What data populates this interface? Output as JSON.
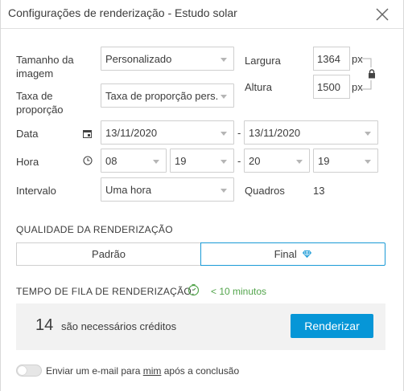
{
  "dialog": {
    "title": "Configurações de renderização - Estudo solar"
  },
  "form": {
    "image_size": {
      "label_line1": "Tamanho da",
      "label_line2": "imagem",
      "value": "Personalizado"
    },
    "aspect_ratio": {
      "label_line1": "Taxa de",
      "label_line2": "proporção",
      "value": "Taxa de proporção pers..."
    },
    "width": {
      "label": "Largura",
      "value": "1364",
      "unit": "px"
    },
    "height": {
      "label": "Altura",
      "value": "1500",
      "unit": "px"
    },
    "date": {
      "label": "Data",
      "start": "13/11/2020",
      "end": "13/11/2020",
      "separator": "-"
    },
    "time": {
      "label": "Hora",
      "start_hour": "08",
      "start_minute": "19",
      "end_hour": "20",
      "end_minute": "19",
      "separator": "-"
    },
    "interval": {
      "label": "Intervalo",
      "value": "Uma hora"
    },
    "frames": {
      "label": "Quadros",
      "value": "13"
    }
  },
  "quality": {
    "title": "QUALIDADE DA RENDERIZAÇÃO",
    "options": [
      "Padrão",
      "Final"
    ],
    "selected": "Final"
  },
  "queue": {
    "label": "TEMPO DE FILA DE RENDERIZAÇÃO:",
    "value": "< 10 minutos"
  },
  "credits": {
    "count": "14",
    "text": "são necessários créditos",
    "render_button": "Renderizar"
  },
  "email": {
    "text_before": "Enviar um e-mail para ",
    "text_link": "mim",
    "text_after": " após a conclusão",
    "enabled": false
  },
  "colors": {
    "accent": "#0696d7",
    "queue_green": "#52a44b"
  }
}
